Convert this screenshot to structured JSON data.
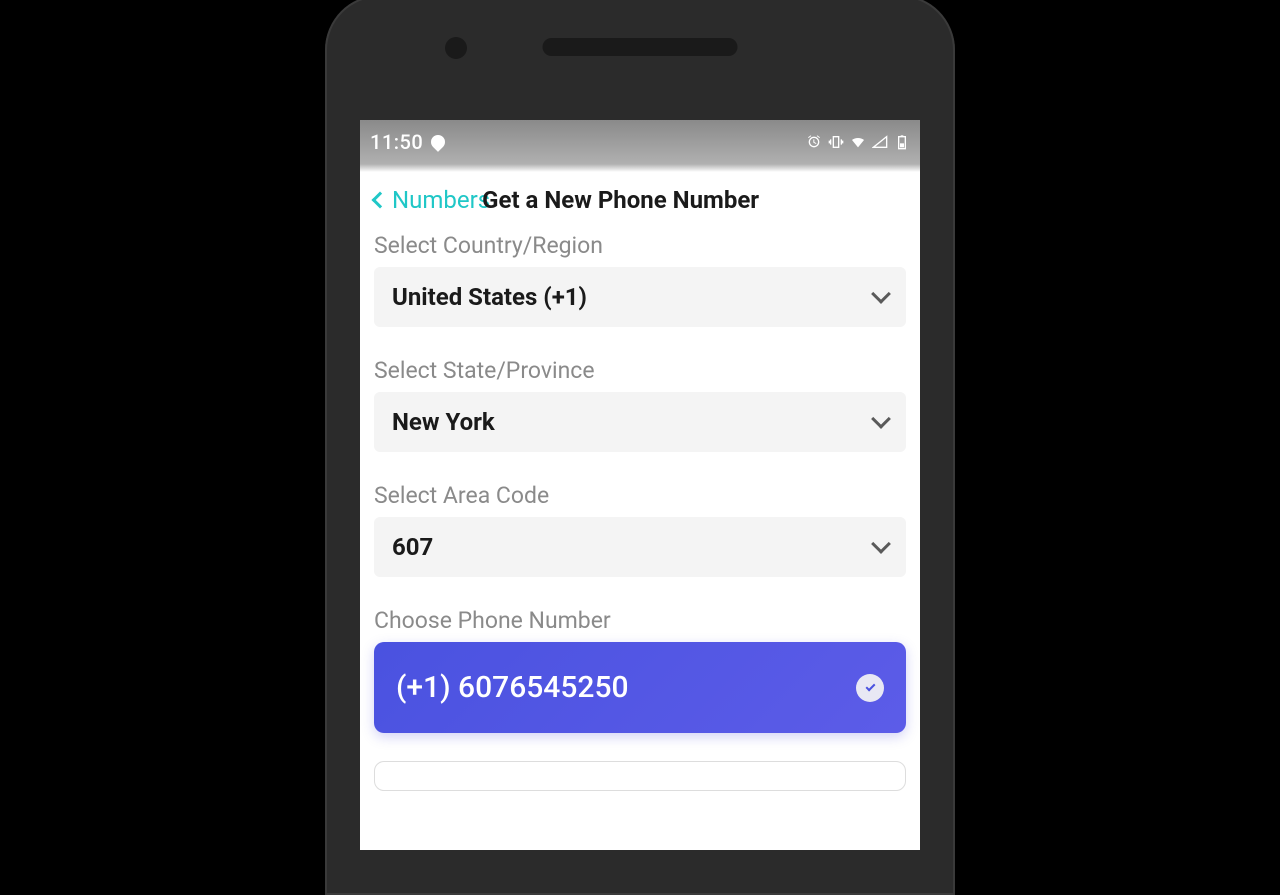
{
  "status_bar": {
    "time": "11:50",
    "icons": [
      "location",
      "alarm",
      "vibrate",
      "wifi",
      "signal",
      "battery"
    ]
  },
  "header": {
    "back_label": "Numbers",
    "title": "Get a New Phone Number"
  },
  "form": {
    "country": {
      "label": "Select Country/Region",
      "value": "United States (+1)"
    },
    "state": {
      "label": "Select State/Province",
      "value": "New York"
    },
    "area_code": {
      "label": "Select Area Code",
      "value": "607"
    },
    "phone_choice": {
      "label": "Choose Phone Number",
      "selected_value": "(+1) 6076545250",
      "selected": true
    }
  },
  "colors": {
    "accent_teal": "#20c7c7",
    "accent_blue": "#4a52e0"
  }
}
